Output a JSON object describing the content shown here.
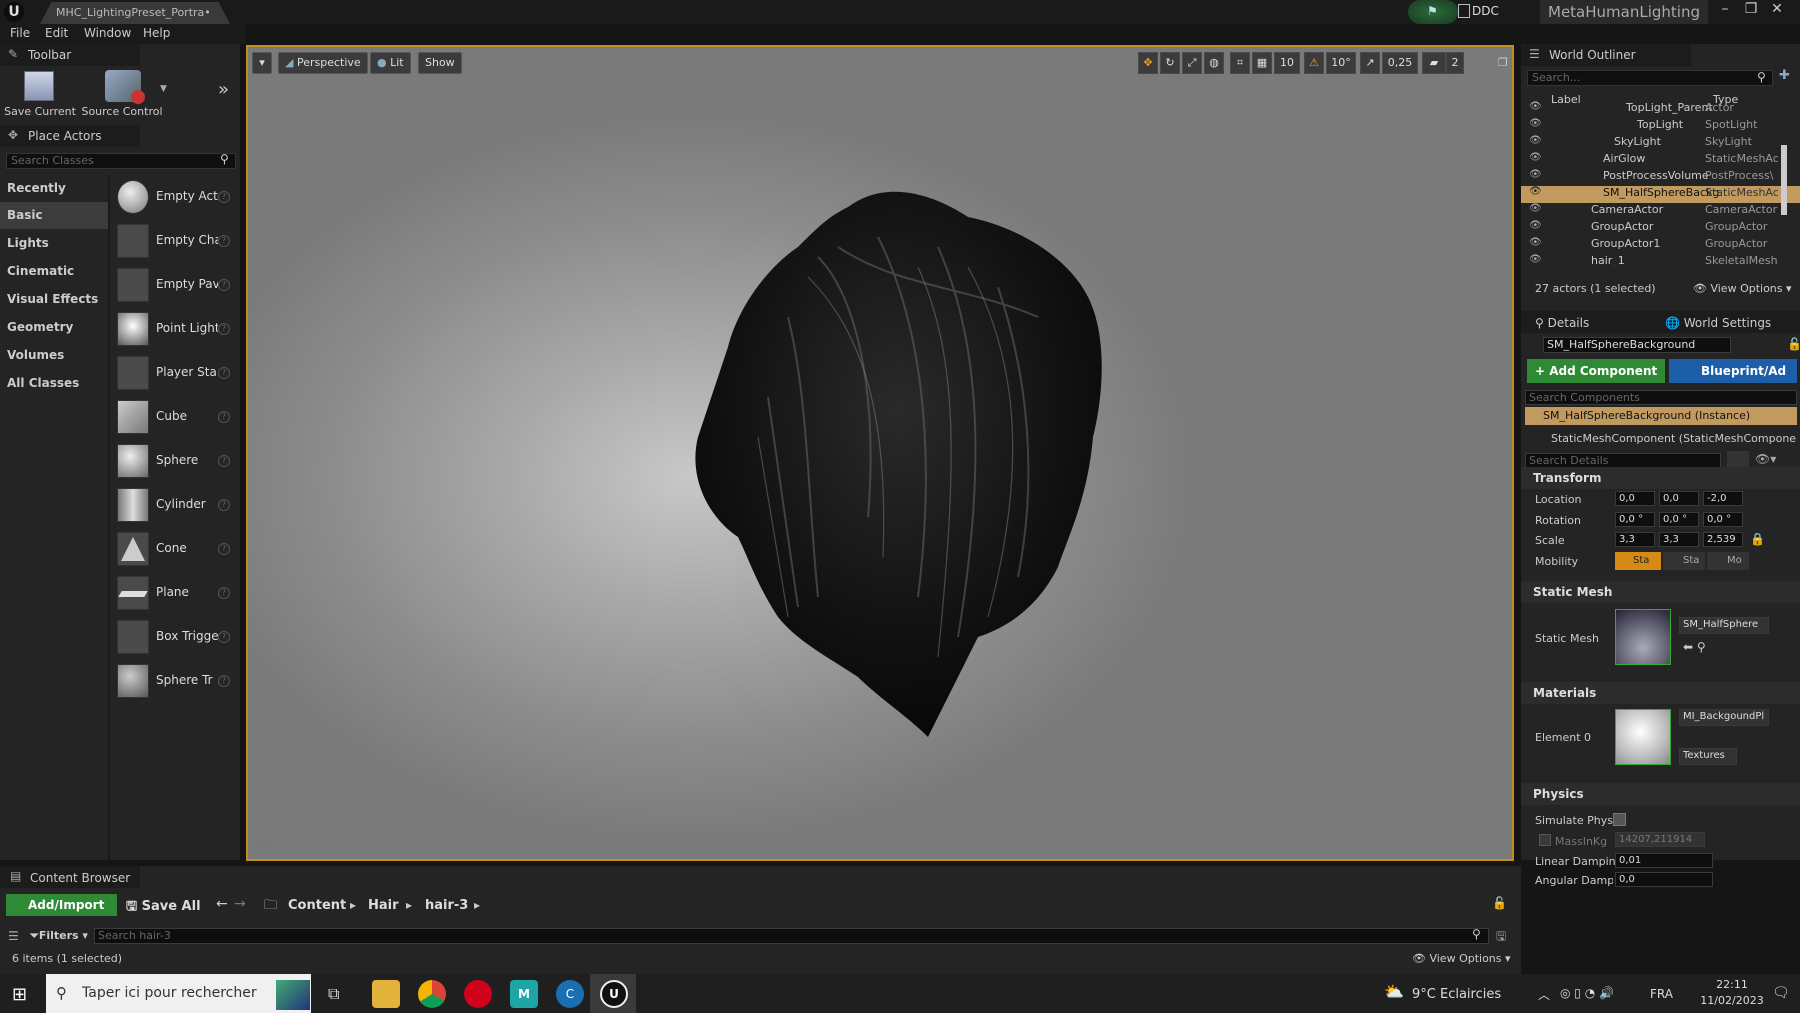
{
  "window": {
    "tab_title": "MHC_LightingPreset_Portra•",
    "ddc": "DDC",
    "project_name": "MetaHumanLighting"
  },
  "menu": [
    "File",
    "Edit",
    "Window",
    "Help"
  ],
  "toolbar": {
    "title": "Toolbar",
    "save_current": "Save Current",
    "source_control": "Source Control"
  },
  "place_actors": {
    "title": "Place Actors",
    "search_placeholder": "Search Classes",
    "categories": [
      "Recently Placed",
      "Basic",
      "Lights",
      "Cinematic",
      "Visual Effects",
      "Geometry",
      "Volumes",
      "All Classes"
    ],
    "selected_category": "Basic",
    "items": [
      "Empty Act",
      "Empty Cha",
      "Empty Pav",
      "Point Light",
      "Player Sta",
      "Cube",
      "Sphere",
      "Cylinder",
      "Cone",
      "Plane",
      "Box Trigge",
      "Sphere Tr"
    ]
  },
  "viewport": {
    "perspective": "Perspective",
    "lit": "Lit",
    "show": "Show",
    "grid_snap": "10",
    "rot_snap": "10°",
    "scale_snap": "0,25",
    "camera_speed": "2"
  },
  "outliner": {
    "title": "World Outliner",
    "search_placeholder": "Search...",
    "col_label": "Label",
    "col_type": "Type",
    "rows": [
      {
        "label": "TopLight_Parent",
        "type": "Actor"
      },
      {
        "label": "TopLight",
        "type": "SpotLight"
      },
      {
        "label": "SkyLight",
        "type": "SkyLight"
      },
      {
        "label": "AirGlow",
        "type": "StaticMeshAc"
      },
      {
        "label": "PostProcessVolume",
        "type": "PostProcess\\"
      },
      {
        "label": "SM_HalfSphereBackg",
        "type": "StaticMeshAc"
      },
      {
        "label": "CameraActor",
        "type": "CameraActor"
      },
      {
        "label": "GroupActor",
        "type": "GroupActor"
      },
      {
        "label": "GroupActor1",
        "type": "GroupActor"
      },
      {
        "label": "hair_1",
        "type": "SkeletalMesh"
      }
    ],
    "status": "27 actors (1 selected)",
    "view_options": "View Options"
  },
  "details": {
    "tab_details": "Details",
    "tab_world": "World Settings",
    "name": "SM_HalfSphereBackground",
    "add_component": "+ Add Component",
    "blueprint": "Blueprint/Ad",
    "search_components": "Search Components",
    "instance": "SM_HalfSphereBackground (Instance)",
    "component": "StaticMeshComponent (StaticMeshComponent",
    "search_details": "Search Details",
    "transform": "Transform",
    "location_label": "Location",
    "location": [
      "0,0",
      "0,0",
      "-2,0"
    ],
    "rotation_label": "Rotation",
    "rotation": [
      "0,0 °",
      "0,0 °",
      "0,0 °"
    ],
    "scale_label": "Scale",
    "scale": [
      "3,3",
      "3,3",
      "2,539"
    ],
    "mobility_label": "Mobility",
    "mobility": [
      "Sta",
      "Sta",
      "Mo"
    ],
    "static_mesh_section": "Static Mesh",
    "static_mesh_label": "Static Mesh",
    "static_mesh_value": "SM_HalfSphere",
    "materials_section": "Materials",
    "element0_label": "Element 0",
    "element0_value": "MI_BackgoundPl",
    "textures": "Textures",
    "physics_section": "Physics",
    "simulate_physics": "Simulate Physic",
    "mass_label": "MassInKg",
    "mass_value": "14207,211914",
    "linear_damping_label": "Linear Damping",
    "linear_damping_value": "0,01",
    "angular_damping_label": "Angular Dampin",
    "angular_damping_value": "0,0"
  },
  "content_browser": {
    "title": "Content Browser",
    "add_import": "Add/Import",
    "save_all": "Save All",
    "path": [
      "Content",
      "Hair",
      "hair-3"
    ],
    "filters": "Filters",
    "search_placeholder": "Search hair-3",
    "status": "6 items (1 selected)",
    "view_options": "View Options"
  },
  "taskbar": {
    "search_placeholder": "Taper ici pour rechercher",
    "weather": "9°C  Eclaircies",
    "lang": "FRA",
    "time": "22:11",
    "date": "11/02/2023"
  }
}
